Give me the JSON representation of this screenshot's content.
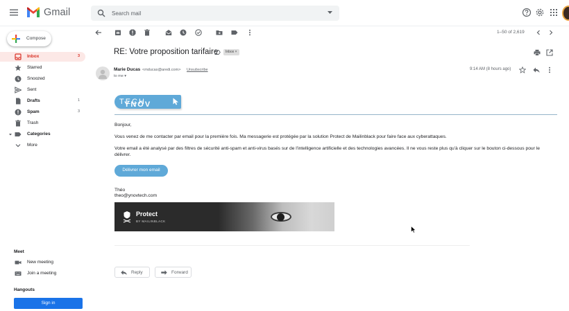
{
  "header": {
    "brand": "Gmail",
    "search_placeholder": "Search mail"
  },
  "colors": {
    "accent": "#1a73e8",
    "inbox_red": "#d93025",
    "ynov_blue": "#5fa9d8"
  },
  "sidebar": {
    "compose_label": "Compose",
    "items": [
      {
        "label": "Inbox",
        "count": "3",
        "icon": "inbox-icon",
        "active": true
      },
      {
        "label": "Starred",
        "count": "",
        "icon": "star-icon"
      },
      {
        "label": "Snoozed",
        "count": "",
        "icon": "clock-icon"
      },
      {
        "label": "Sent",
        "count": "",
        "icon": "send-icon"
      },
      {
        "label": "Drafts",
        "count": "1",
        "icon": "draft-icon"
      },
      {
        "label": "Spam",
        "count": "3",
        "icon": "spam-icon"
      },
      {
        "label": "Trash",
        "count": "",
        "icon": "trash-icon"
      },
      {
        "label": "Categories",
        "count": "",
        "icon": "label-icon"
      },
      {
        "label": "More",
        "count": "",
        "icon": "chevron-down-icon"
      }
    ],
    "meet": {
      "title": "Meet",
      "new_meeting": "New meeting",
      "join_meeting": "Join a meeting"
    },
    "hangouts": {
      "title": "Hangouts",
      "sign_in": "Sign in"
    }
  },
  "toolbar": {
    "pager": "1–50 of 2,619"
  },
  "email": {
    "subject": "RE: Votre proposition tarifaire",
    "label_chip": "Inbox ×",
    "sender_name": "Marie Ducas",
    "sender_email": "<mducas@aredi.com>",
    "unsubscribe": "Unsubscribe",
    "to_me": "to me ▾",
    "time": "9:14 AM (8 hours ago)",
    "body": {
      "logo_bold": "YNOV",
      "logo_light": "TECH",
      "greeting": "Bonjour,",
      "para1": "Vous venez de me contacter par email pour la première fois. Ma messagerie est protégée par la solution Protect de Mailinblack pour faire face aux cyberattaques.",
      "para2": "Votre email a été analysé par des filtres de sécurité anti-spam et anti-virus basés sur de l'intelligence artificielle et des technologies avancées. Il ne vous reste plus qu'à cliquer sur le bouton ci-dessous pour le délivrer.",
      "deliver_button": "Délivrer mon email",
      "sign_name": "Théo",
      "sign_email": "theo@ynovtech.com",
      "banner_title": "Protect",
      "banner_sub": "BY MAILINBLACK"
    },
    "actions": {
      "reply": "Reply",
      "forward": "Forward"
    }
  }
}
